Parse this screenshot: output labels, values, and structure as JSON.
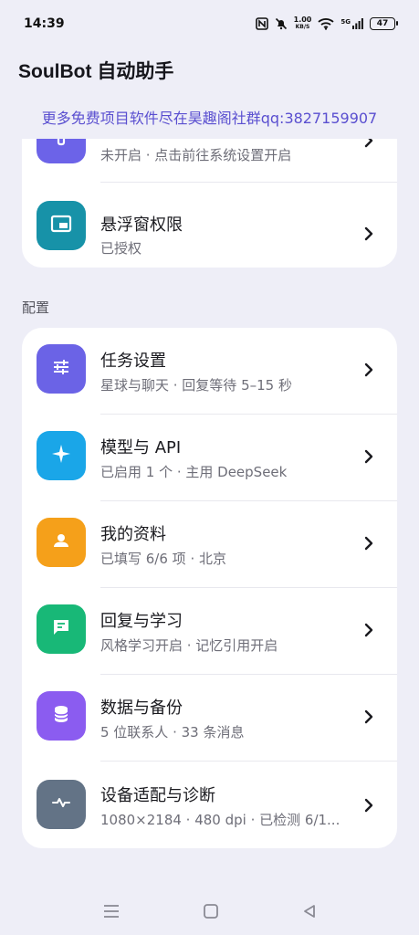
{
  "status_bar": {
    "time": "14:39",
    "net_speed_value": "1.00",
    "net_speed_unit": "KB/S",
    "network_type": "5G",
    "battery": "47"
  },
  "header": {
    "title": "SoulBot 自动助手",
    "promo": "更多免费项目软件尽在昊趣阁社群qq:3827159907"
  },
  "permissions_card": {
    "items": [
      {
        "title": "",
        "subtitle": "未开启 · 点击前往系统设置开启",
        "icon": "accessibility-icon",
        "color": "#6c63e8"
      },
      {
        "title": "悬浮窗权限",
        "subtitle": "已授权",
        "icon": "picture-in-picture-icon",
        "color": "#1792a8"
      }
    ]
  },
  "config_section": {
    "label": "配置",
    "items": [
      {
        "title": "任务设置",
        "subtitle": "星球与聊天 · 回复等待 5–15 秒",
        "icon": "sliders-icon",
        "color": "#6b63e6"
      },
      {
        "title": "模型与 API",
        "subtitle": "已启用 1 个 · 主用 DeepSeek",
        "icon": "sparkle-icon",
        "color": "#1aa6e8"
      },
      {
        "title": "我的资料",
        "subtitle": "已填写 6/6 项 · 北京",
        "icon": "user-icon",
        "color": "#f5a01a"
      },
      {
        "title": "回复与学习",
        "subtitle": "风格学习开启 · 记忆引用开启",
        "icon": "chat-icon",
        "color": "#18b877"
      },
      {
        "title": "数据与备份",
        "subtitle": "5 位联系人 · 33 条消息",
        "icon": "database-icon",
        "color": "#8b5cf0"
      },
      {
        "title": "设备适配与诊断",
        "subtitle": "1080×2184 · 480 dpi · 已检测 6/1...",
        "icon": "pulse-icon",
        "color": "#637386"
      }
    ]
  },
  "nav_bar": {
    "icons": [
      "menu-icon",
      "home-icon",
      "back-icon"
    ]
  }
}
